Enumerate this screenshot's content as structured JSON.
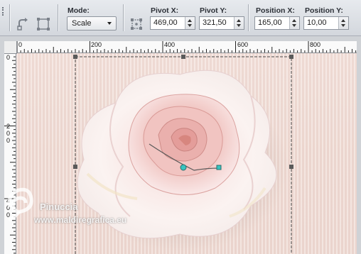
{
  "toolbar": {
    "mode_label": "Mode:",
    "mode_value": "Scale",
    "pivot_x_label": "Pivot X:",
    "pivot_x_value": "469,00",
    "pivot_y_label": "Pivot Y:",
    "pivot_y_value": "321,50",
    "position_x_label": "Position X:",
    "position_x_value": "165,00",
    "position_y_label": "Position Y:",
    "position_y_value": "10,00",
    "icons": [
      "rotate-tool-icon",
      "perspective-tool-icon",
      "pick-mode-icon"
    ]
  },
  "ruler": {
    "h_labels": [
      "0",
      "200",
      "400",
      "600",
      "800"
    ],
    "v_labels": [
      "0",
      "2\n0\n0",
      "4\n0\n0"
    ]
  },
  "watermark": {
    "name": "Pinuccia",
    "url": "www.maldiregrafica.eu"
  },
  "colors": {
    "toolbar_bg": "#dfe2e6",
    "canvas_bg": "#f0ddd6",
    "handle_color": "#5a5a5a",
    "pivot_color": "#37c4c0"
  }
}
